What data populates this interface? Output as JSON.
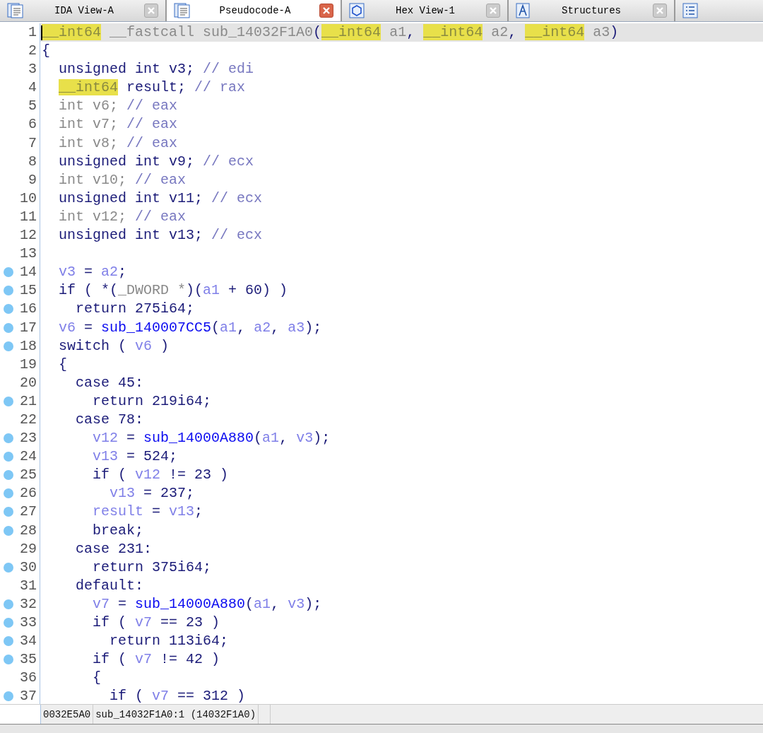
{
  "tabs": [
    {
      "label": "IDA View-A",
      "kind": "disasm",
      "selected": false
    },
    {
      "label": "Pseudocode-A",
      "kind": "pseudocode",
      "selected": true
    },
    {
      "label": "Hex View-1",
      "kind": "hex",
      "selected": false
    },
    {
      "label": "Structures",
      "kind": "structures",
      "selected": false
    },
    {
      "kind": "list",
      "selected": false
    }
  ],
  "code_lines": [
    {
      "number": "1",
      "breakpoint": false,
      "current": true,
      "tokens": [
        {
          "text": "__int64",
          "kind": "type_hl"
        },
        {
          "text": " __fastcall sub_14032F1A0",
          "kind": "dim"
        },
        {
          "text": "(",
          "kind": "plain"
        },
        {
          "text": "__int64",
          "kind": "type_hl"
        },
        {
          "text": " a1",
          "kind": "dim"
        },
        {
          "text": ", ",
          "kind": "plain"
        },
        {
          "text": "__int64",
          "kind": "type_hl"
        },
        {
          "text": " a2",
          "kind": "dim"
        },
        {
          "text": ", ",
          "kind": "plain"
        },
        {
          "text": "__int64",
          "kind": "type_hl"
        },
        {
          "text": " a3",
          "kind": "dim"
        },
        {
          "text": ")",
          "kind": "plain"
        }
      ]
    },
    {
      "number": "2",
      "breakpoint": false,
      "current": false,
      "tokens": [
        {
          "text": "{",
          "kind": "plain"
        }
      ]
    },
    {
      "number": "3",
      "breakpoint": false,
      "current": false,
      "tokens": [
        {
          "text": "  unsigned int v3; ",
          "kind": "plain"
        },
        {
          "text": "// edi",
          "kind": "comment"
        }
      ]
    },
    {
      "number": "4",
      "breakpoint": false,
      "current": false,
      "tokens": [
        {
          "text": "  __int64",
          "kind": "type_hl"
        },
        {
          "text": " result; ",
          "kind": "plain"
        },
        {
          "text": "// rax",
          "kind": "comment"
        }
      ]
    },
    {
      "number": "5",
      "breakpoint": false,
      "current": false,
      "tokens": [
        {
          "text": "  int v6; ",
          "kind": "dim"
        },
        {
          "text": "// eax",
          "kind": "comment"
        }
      ]
    },
    {
      "number": "6",
      "breakpoint": false,
      "current": false,
      "tokens": [
        {
          "text": "  int v7; ",
          "kind": "dim"
        },
        {
          "text": "// eax",
          "kind": "comment"
        }
      ]
    },
    {
      "number": "7",
      "breakpoint": false,
      "current": false,
      "tokens": [
        {
          "text": "  int v8; ",
          "kind": "dim"
        },
        {
          "text": "// eax",
          "kind": "comment"
        }
      ]
    },
    {
      "number": "8",
      "breakpoint": false,
      "current": false,
      "tokens": [
        {
          "text": "  unsigned int v9; ",
          "kind": "plain"
        },
        {
          "text": "// ecx",
          "kind": "comment"
        }
      ]
    },
    {
      "number": "9",
      "breakpoint": false,
      "current": false,
      "tokens": [
        {
          "text": "  int v10; ",
          "kind": "dim"
        },
        {
          "text": "// eax",
          "kind": "comment"
        }
      ]
    },
    {
      "number": "10",
      "breakpoint": false,
      "current": false,
      "tokens": [
        {
          "text": "  unsigned int v11; ",
          "kind": "plain"
        },
        {
          "text": "// ecx",
          "kind": "comment"
        }
      ]
    },
    {
      "number": "11",
      "breakpoint": false,
      "current": false,
      "tokens": [
        {
          "text": "  int v12; ",
          "kind": "dim"
        },
        {
          "text": "// eax",
          "kind": "comment"
        }
      ]
    },
    {
      "number": "12",
      "breakpoint": false,
      "current": false,
      "tokens": [
        {
          "text": "  unsigned int v13; ",
          "kind": "plain"
        },
        {
          "text": "// ecx",
          "kind": "comment"
        }
      ]
    },
    {
      "number": "13",
      "breakpoint": false,
      "current": false
    },
    {
      "number": "14",
      "breakpoint": true,
      "current": false,
      "tokens": [
        {
          "text": "  v3",
          "kind": "var"
        },
        {
          "text": " = ",
          "kind": "plain"
        },
        {
          "text": "a2",
          "kind": "var"
        },
        {
          "text": ";",
          "kind": "plain"
        }
      ]
    },
    {
      "number": "15",
      "breakpoint": true,
      "current": false,
      "tokens": [
        {
          "text": "  if ( *(",
          "kind": "plain"
        },
        {
          "text": "_DWORD *",
          "kind": "dim"
        },
        {
          "text": ")(",
          "kind": "plain"
        },
        {
          "text": "a1",
          "kind": "var"
        },
        {
          "text": " + 60) )",
          "kind": "plain"
        }
      ]
    },
    {
      "number": "16",
      "breakpoint": true,
      "current": false,
      "tokens": [
        {
          "text": "    return 275i64;",
          "kind": "plain"
        }
      ]
    },
    {
      "number": "17",
      "breakpoint": true,
      "current": false,
      "tokens": [
        {
          "text": "  v6",
          "kind": "var"
        },
        {
          "text": " = ",
          "kind": "plain"
        },
        {
          "text": "sub_140007CC5",
          "kind": "func"
        },
        {
          "text": "(",
          "kind": "plain"
        },
        {
          "text": "a1",
          "kind": "var"
        },
        {
          "text": ", ",
          "kind": "plain"
        },
        {
          "text": "a2",
          "kind": "var"
        },
        {
          "text": ", ",
          "kind": "plain"
        },
        {
          "text": "a3",
          "kind": "var"
        },
        {
          "text": ");",
          "kind": "plain"
        }
      ]
    },
    {
      "number": "18",
      "breakpoint": true,
      "current": false,
      "tokens": [
        {
          "text": "  switch ( ",
          "kind": "plain"
        },
        {
          "text": "v6",
          "kind": "var"
        },
        {
          "text": " )",
          "kind": "plain"
        }
      ]
    },
    {
      "number": "19",
      "breakpoint": false,
      "current": false,
      "tokens": [
        {
          "text": "  {",
          "kind": "plain"
        }
      ]
    },
    {
      "number": "20",
      "breakpoint": false,
      "current": false,
      "tokens": [
        {
          "text": "    case 45:",
          "kind": "plain"
        }
      ]
    },
    {
      "number": "21",
      "breakpoint": true,
      "current": false,
      "tokens": [
        {
          "text": "      return 219i64;",
          "kind": "plain"
        }
      ]
    },
    {
      "number": "22",
      "breakpoint": false,
      "current": false,
      "tokens": [
        {
          "text": "    case 78:",
          "kind": "plain"
        }
      ]
    },
    {
      "number": "23",
      "breakpoint": true,
      "current": false,
      "tokens": [
        {
          "text": "      v12",
          "kind": "var"
        },
        {
          "text": " = ",
          "kind": "plain"
        },
        {
          "text": "sub_14000A880",
          "kind": "func"
        },
        {
          "text": "(",
          "kind": "plain"
        },
        {
          "text": "a1",
          "kind": "var"
        },
        {
          "text": ", ",
          "kind": "plain"
        },
        {
          "text": "v3",
          "kind": "var"
        },
        {
          "text": ");",
          "kind": "plain"
        }
      ]
    },
    {
      "number": "24",
      "breakpoint": true,
      "current": false,
      "tokens": [
        {
          "text": "      v13",
          "kind": "var"
        },
        {
          "text": " = 524;",
          "kind": "plain"
        }
      ]
    },
    {
      "number": "25",
      "breakpoint": true,
      "current": false,
      "tokens": [
        {
          "text": "      if ( ",
          "kind": "plain"
        },
        {
          "text": "v12",
          "kind": "var"
        },
        {
          "text": " != 23 )",
          "kind": "plain"
        }
      ]
    },
    {
      "number": "26",
      "breakpoint": true,
      "current": false,
      "tokens": [
        {
          "text": "        v13",
          "kind": "var"
        },
        {
          "text": " = 237;",
          "kind": "plain"
        }
      ]
    },
    {
      "number": "27",
      "breakpoint": true,
      "current": false,
      "tokens": [
        {
          "text": "      result",
          "kind": "var"
        },
        {
          "text": " = ",
          "kind": "plain"
        },
        {
          "text": "v13",
          "kind": "var"
        },
        {
          "text": ";",
          "kind": "plain"
        }
      ]
    },
    {
      "number": "28",
      "breakpoint": true,
      "current": false,
      "tokens": [
        {
          "text": "      break;",
          "kind": "plain"
        }
      ]
    },
    {
      "number": "29",
      "breakpoint": false,
      "current": false,
      "tokens": [
        {
          "text": "    case 231:",
          "kind": "plain"
        }
      ]
    },
    {
      "number": "30",
      "breakpoint": true,
      "current": false,
      "tokens": [
        {
          "text": "      return 375i64;",
          "kind": "plain"
        }
      ]
    },
    {
      "number": "31",
      "breakpoint": false,
      "current": false,
      "tokens": [
        {
          "text": "    default:",
          "kind": "plain"
        }
      ]
    },
    {
      "number": "32",
      "breakpoint": true,
      "current": false,
      "tokens": [
        {
          "text": "      v7",
          "kind": "var"
        },
        {
          "text": " = ",
          "kind": "plain"
        },
        {
          "text": "sub_14000A880",
          "kind": "func"
        },
        {
          "text": "(",
          "kind": "plain"
        },
        {
          "text": "a1",
          "kind": "var"
        },
        {
          "text": ", ",
          "kind": "plain"
        },
        {
          "text": "v3",
          "kind": "var"
        },
        {
          "text": ");",
          "kind": "plain"
        }
      ]
    },
    {
      "number": "33",
      "breakpoint": true,
      "current": false,
      "tokens": [
        {
          "text": "      if ( ",
          "kind": "plain"
        },
        {
          "text": "v7",
          "kind": "var"
        },
        {
          "text": " == 23 )",
          "kind": "plain"
        }
      ]
    },
    {
      "number": "34",
      "breakpoint": true,
      "current": false,
      "tokens": [
        {
          "text": "        return 113i64;",
          "kind": "plain"
        }
      ]
    },
    {
      "number": "35",
      "breakpoint": true,
      "current": false,
      "tokens": [
        {
          "text": "      if ( ",
          "kind": "plain"
        },
        {
          "text": "v7",
          "kind": "var"
        },
        {
          "text": " != 42 )",
          "kind": "plain"
        }
      ]
    },
    {
      "number": "36",
      "breakpoint": false,
      "current": false,
      "tokens": [
        {
          "text": "      {",
          "kind": "plain"
        }
      ]
    },
    {
      "number": "37",
      "breakpoint": true,
      "current": false,
      "tokens": [
        {
          "text": "        if ( ",
          "kind": "plain"
        },
        {
          "text": "v7",
          "kind": "var"
        },
        {
          "text": " == 312 )",
          "kind": "plain"
        }
      ]
    }
  ],
  "status_bar": {
    "address": "0032E5A0",
    "location": "sub_14032F1A0:1 (14032F1A0)"
  }
}
